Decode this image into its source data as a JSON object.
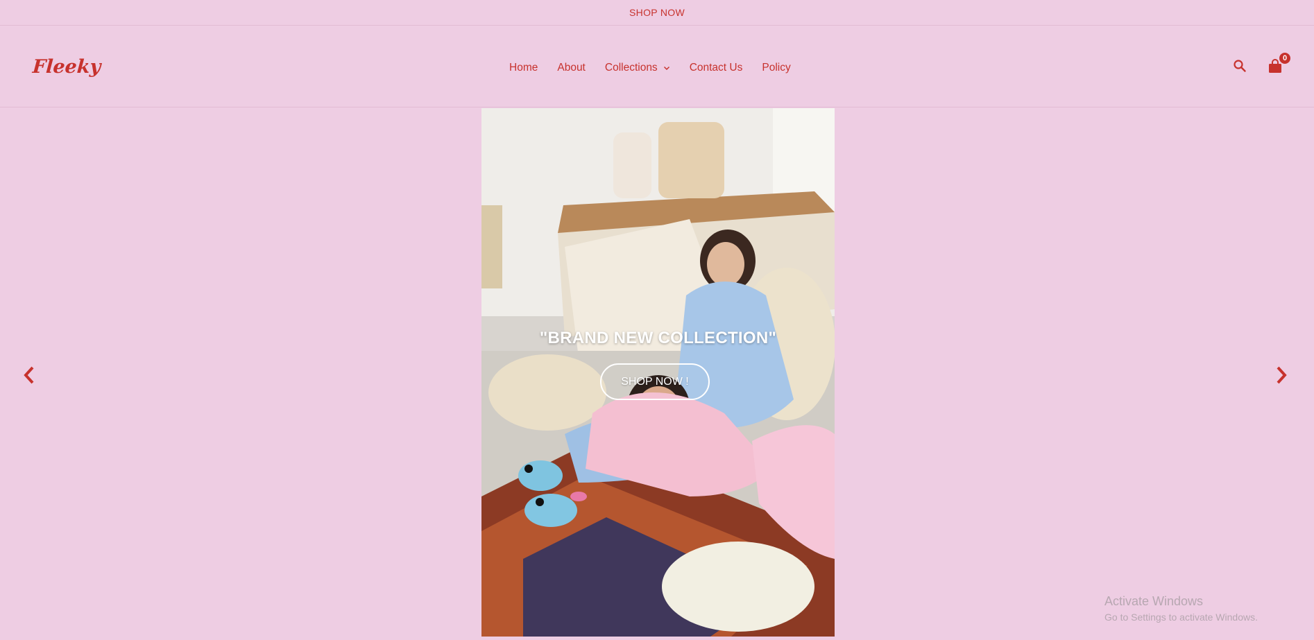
{
  "announcement": {
    "link": "SHOP NOW"
  },
  "header": {
    "logo": "Fleeky",
    "nav": [
      {
        "label": "Home"
      },
      {
        "label": "About"
      },
      {
        "label": "Collections",
        "has_dropdown": true
      },
      {
        "label": "Contact Us"
      },
      {
        "label": "Policy"
      }
    ],
    "cart_count": "0"
  },
  "hero": {
    "title": "\"BRAND NEW COLLECTION\"",
    "button_label": "SHOP NOW !"
  },
  "colors": {
    "background": "#eecde3",
    "accent": "#c7322d"
  },
  "icons": {
    "search": "search-icon",
    "cart": "shopping-bag-icon",
    "prev": "chevron-left-icon",
    "next": "chevron-right-icon"
  },
  "watermark": {
    "line1": "Activate Windows",
    "line2": "Go to Settings to activate Windows."
  }
}
